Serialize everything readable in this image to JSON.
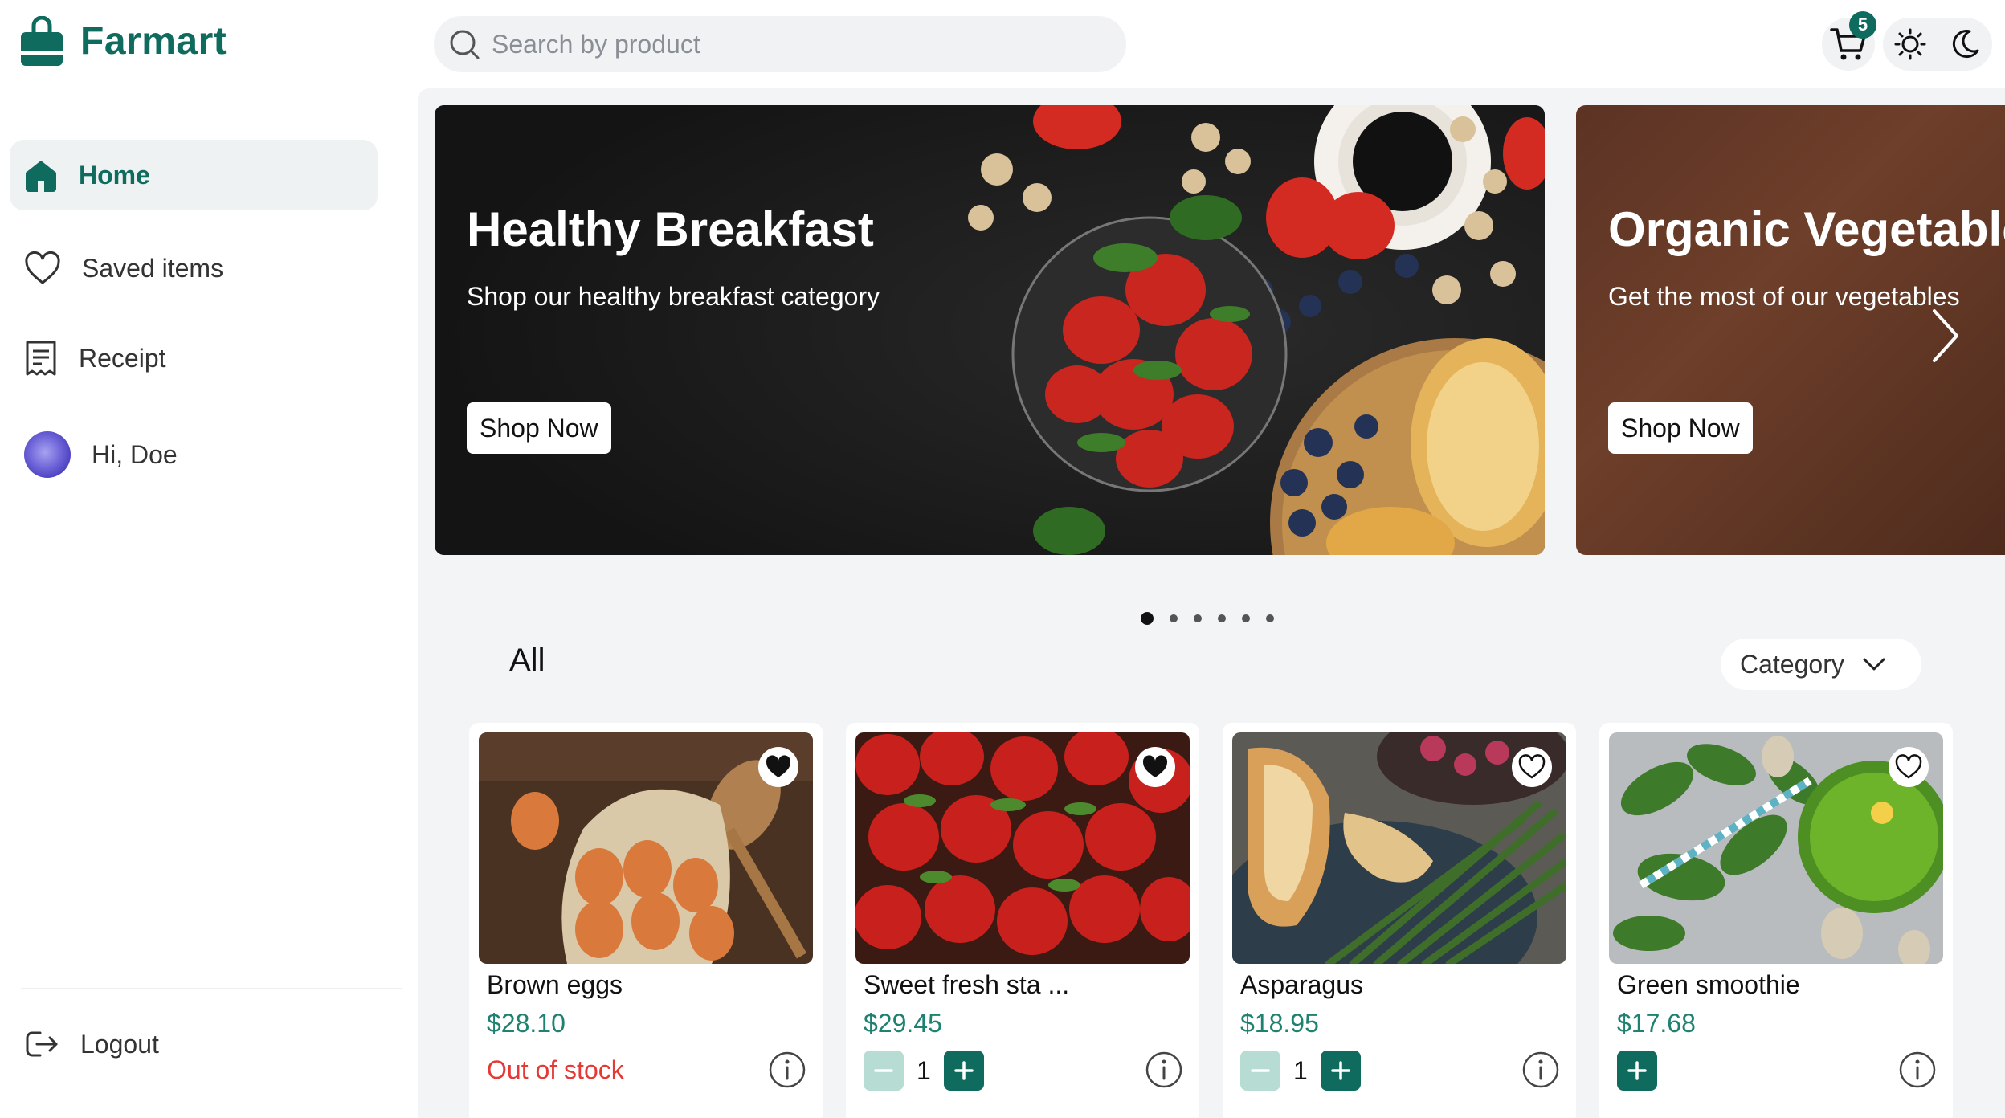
{
  "app": {
    "name": "Farmart",
    "brand_color": "#0f6b5d"
  },
  "sidebar": {
    "items": [
      {
        "label": "Home",
        "icon": "home-icon",
        "active": true
      },
      {
        "label": "Saved items",
        "icon": "heart-icon",
        "active": false
      },
      {
        "label": "Receipt",
        "icon": "receipt-icon",
        "active": false
      },
      {
        "label": "Hi, Doe",
        "icon": "avatar",
        "active": false
      }
    ],
    "logout_label": "Logout"
  },
  "header": {
    "search_placeholder": "Search by product",
    "cart_count": "5",
    "theme_icons": [
      "sun-icon",
      "moon-icon"
    ]
  },
  "banners": [
    {
      "title": "Healthy Breakfast",
      "subtitle": "Shop our healthy breakfast category",
      "button": "Shop Now"
    },
    {
      "title": "Organic Vegetables",
      "subtitle": "Get the most of our vegetables",
      "button": "Shop Now"
    }
  ],
  "carousel": {
    "slide_count": 6,
    "active_index": 0
  },
  "products_section": {
    "title": "All",
    "category_label": "Category"
  },
  "products": [
    {
      "name": "Brown eggs",
      "price": "$28.10",
      "status": "Out of stock",
      "saved": true
    },
    {
      "name": "Sweet fresh sta ...",
      "price": "$29.45",
      "quantity": "1",
      "saved": true
    },
    {
      "name": "Asparagus",
      "price": "$18.95",
      "quantity": "1",
      "saved": false
    },
    {
      "name": "Green smoothie",
      "price": "$17.68",
      "saved": false
    }
  ]
}
